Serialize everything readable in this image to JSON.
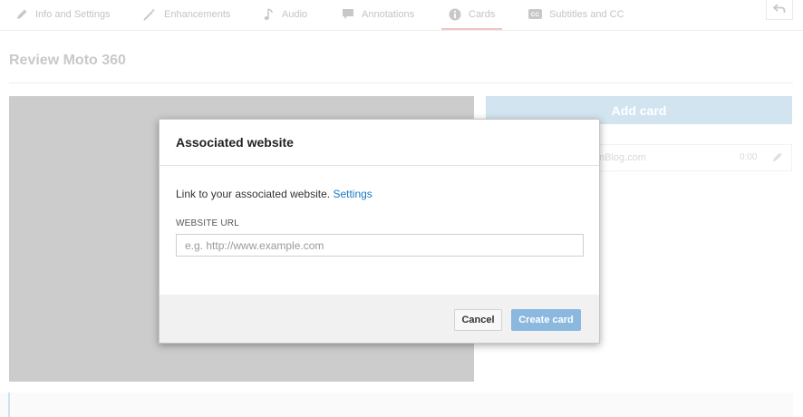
{
  "tabs": [
    {
      "label": "Info and Settings",
      "icon": "pencil-icon"
    },
    {
      "label": "Enhancements",
      "icon": "magic-wand-icon"
    },
    {
      "label": "Audio",
      "icon": "music-note-icon"
    },
    {
      "label": "Annotations",
      "icon": "speech-bubble-icon"
    },
    {
      "label": "Cards",
      "icon": "info-circle-icon",
      "active": true
    },
    {
      "label": "Subtitles and CC",
      "icon": "cc-icon"
    }
  ],
  "undo_icon": "undo-arrow-icon",
  "page": {
    "title": "Review Moto 360"
  },
  "sidebar": {
    "add_card_label": "Add card",
    "card": {
      "name_visible": "nBlog.com",
      "time": "0:00",
      "icon": "pencil-icon"
    }
  },
  "modal": {
    "title": "Associated website",
    "description": "Link to your associated website.",
    "settings_link": "Settings",
    "field_label": "WEBSITE URL",
    "url_value": "",
    "url_placeholder": "e.g. http://www.example.com",
    "cancel_label": "Cancel",
    "create_label": "Create card"
  },
  "colors": {
    "accent_link": "#167ac6",
    "create_button": "#8bb8df",
    "add_card_button": "#d3e4f1",
    "active_tab_underline": "#f1c4c1",
    "video_placeholder": "#cccccc"
  }
}
